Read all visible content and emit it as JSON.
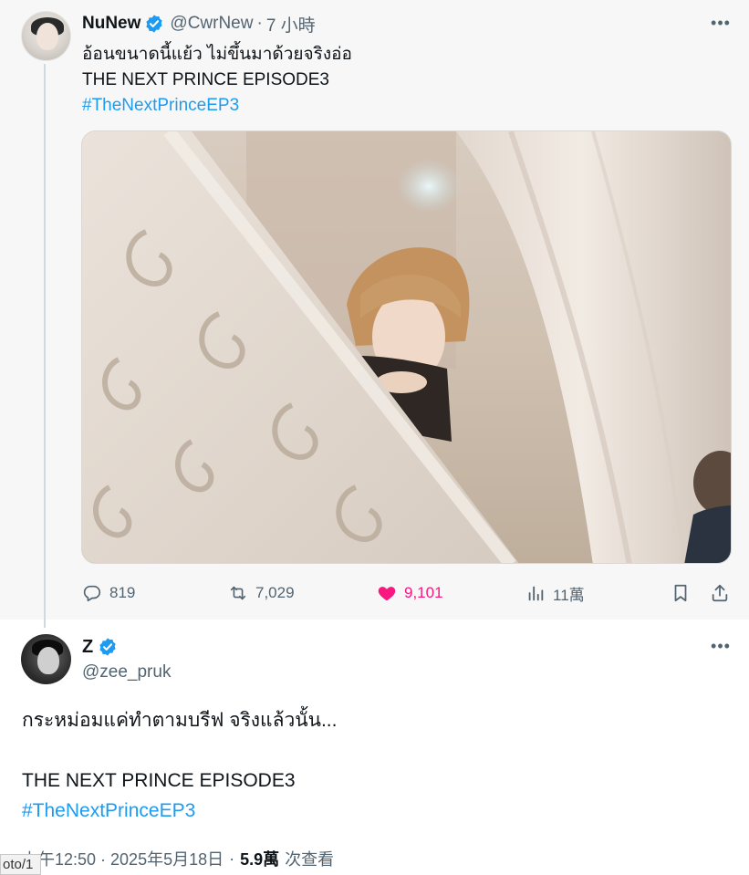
{
  "tweet1": {
    "author_name": "NuNew",
    "author_handle": "@CwrNew",
    "separator": "·",
    "time_ago": "7 小時",
    "more_label": "•••",
    "text_line1": "อ้อนขนาดนี้แย้ว ไม่ขึ้นมาด้วยจริงอ่อ",
    "text_line2": "THE NEXT PRINCE EPISODE3",
    "hashtag": "#TheNextPrinceEP3",
    "stats": {
      "replies": "819",
      "reposts": "7,029",
      "likes": "9,101",
      "views": "11萬"
    },
    "colors": {
      "like_active": "#f91880",
      "hashtag": "#1d9bf0",
      "verified": "#1d9bf0"
    }
  },
  "tweet2": {
    "author_name": "Z",
    "author_handle": "@zee_pruk",
    "more_label": "•••",
    "text_line1": "กระหม่อมแค่ทำตามบรีฟ จริงแล้วนั้น...",
    "text_line2": "THE NEXT PRINCE EPISODE3",
    "hashtag": "#TheNextPrinceEP3",
    "timestamp": "上午12:50 · 2025年5月18日",
    "separator": "·",
    "views_count": "5.9萬",
    "views_label": "次查看"
  },
  "status_tooltip": "oto/1"
}
